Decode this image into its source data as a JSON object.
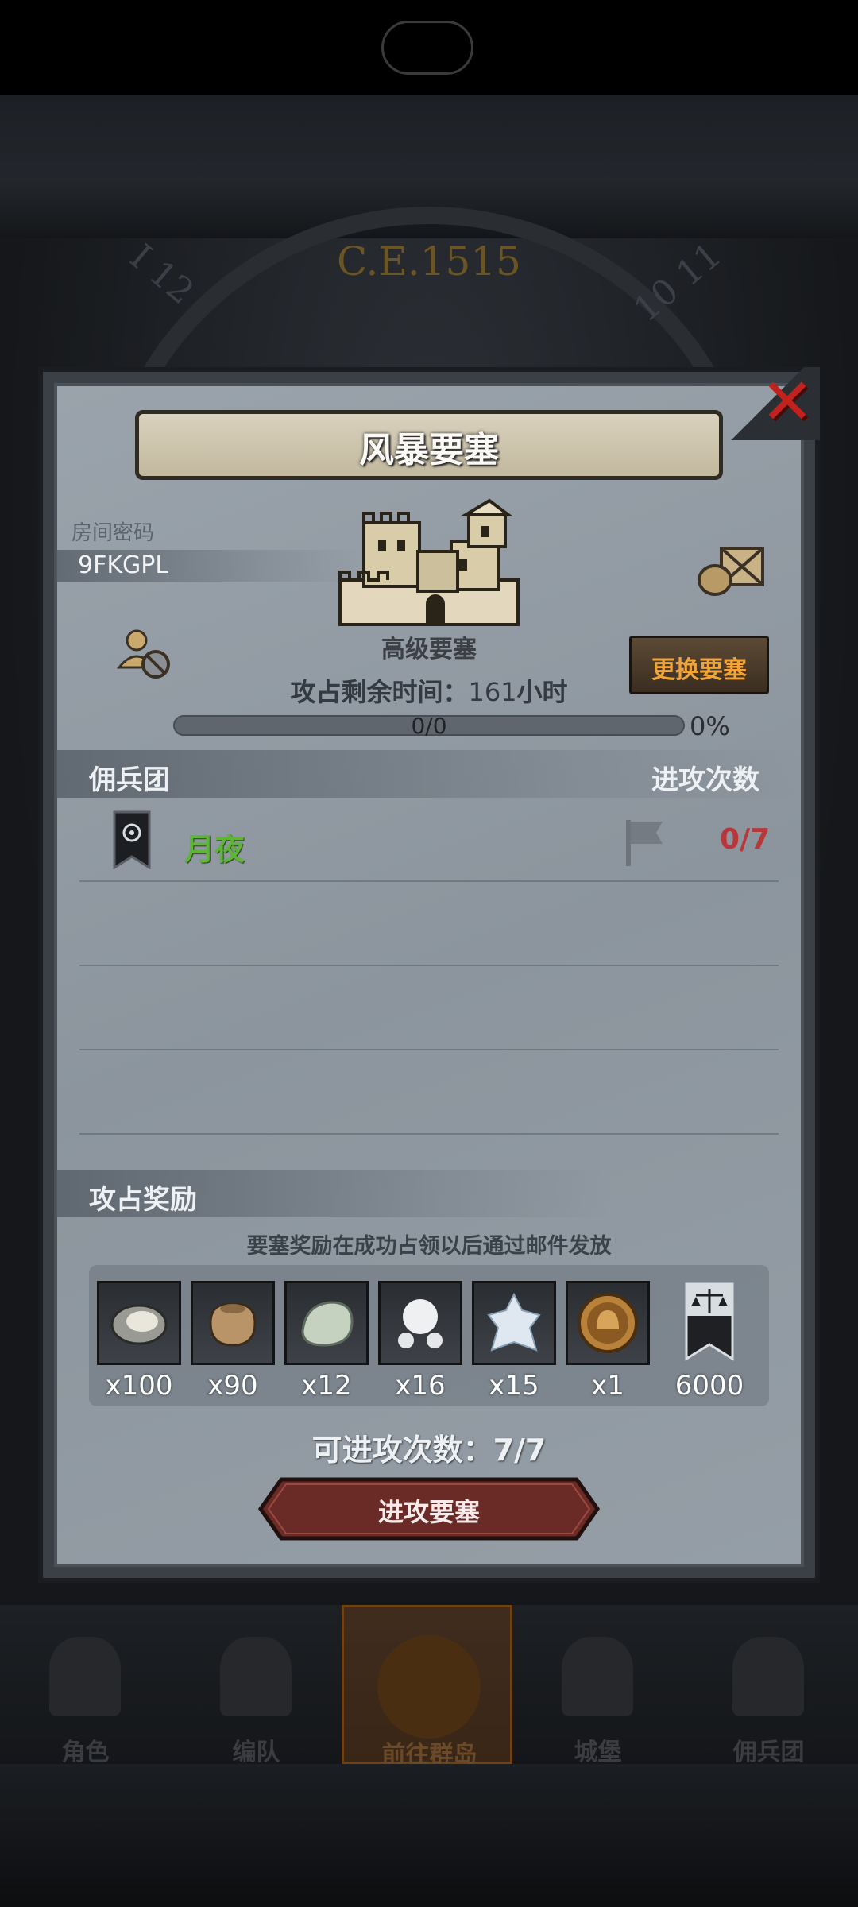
{
  "background": {
    "era": "C.E.1515"
  },
  "dialog": {
    "title": "风暴要塞",
    "close_icon": "close-x-icon",
    "room_code_label": "房间密码",
    "room_code": "9FKGPL",
    "fortress_type": "高级要塞",
    "change_button": "更换要塞",
    "remaining_time_label": "攻占剩余时间：",
    "remaining_time_value": "161",
    "remaining_time_unit": "小时",
    "progress_text": "0/0",
    "progress_percent": "0%",
    "progress_fraction": 0,
    "mercenary_header": "佣兵团",
    "attacks_header": "进攻次数",
    "guilds": [
      {
        "name": "月夜",
        "attacks": "0/7"
      }
    ],
    "reward_header": "攻占奖励",
    "reward_note": "要塞奖励在成功占领以后通过邮件发放",
    "rewards": [
      {
        "icon": "oyster-icon",
        "qty": "x100"
      },
      {
        "icon": "sack-icon",
        "qty": "x90"
      },
      {
        "icon": "stone-icon",
        "qty": "x12"
      },
      {
        "icon": "pearl-icon",
        "qty": "x16"
      },
      {
        "icon": "crystal-icon",
        "qty": "x15"
      },
      {
        "icon": "helmet-coin-icon",
        "qty": "x1"
      },
      {
        "icon": "scales-banner-icon",
        "qty": "6000"
      }
    ],
    "attack_count": "可进攻次数：7/7",
    "attack_button": "进攻要塞"
  },
  "bottom_nav": [
    {
      "label": "角色",
      "icon": "character-icon",
      "active": false
    },
    {
      "label": "编队",
      "icon": "formation-icon",
      "active": false
    },
    {
      "label": "前往群岛",
      "icon": "islands-icon",
      "active": true
    },
    {
      "label": "城堡",
      "icon": "castle-icon",
      "active": false
    },
    {
      "label": "佣兵团",
      "icon": "mercenary-icon",
      "active": false
    }
  ],
  "colors": {
    "guild_name": "#5fb43a",
    "attacks_value": "#b8373a",
    "change_button_text": "#f0a43a",
    "close_icon": "#c0231d"
  }
}
